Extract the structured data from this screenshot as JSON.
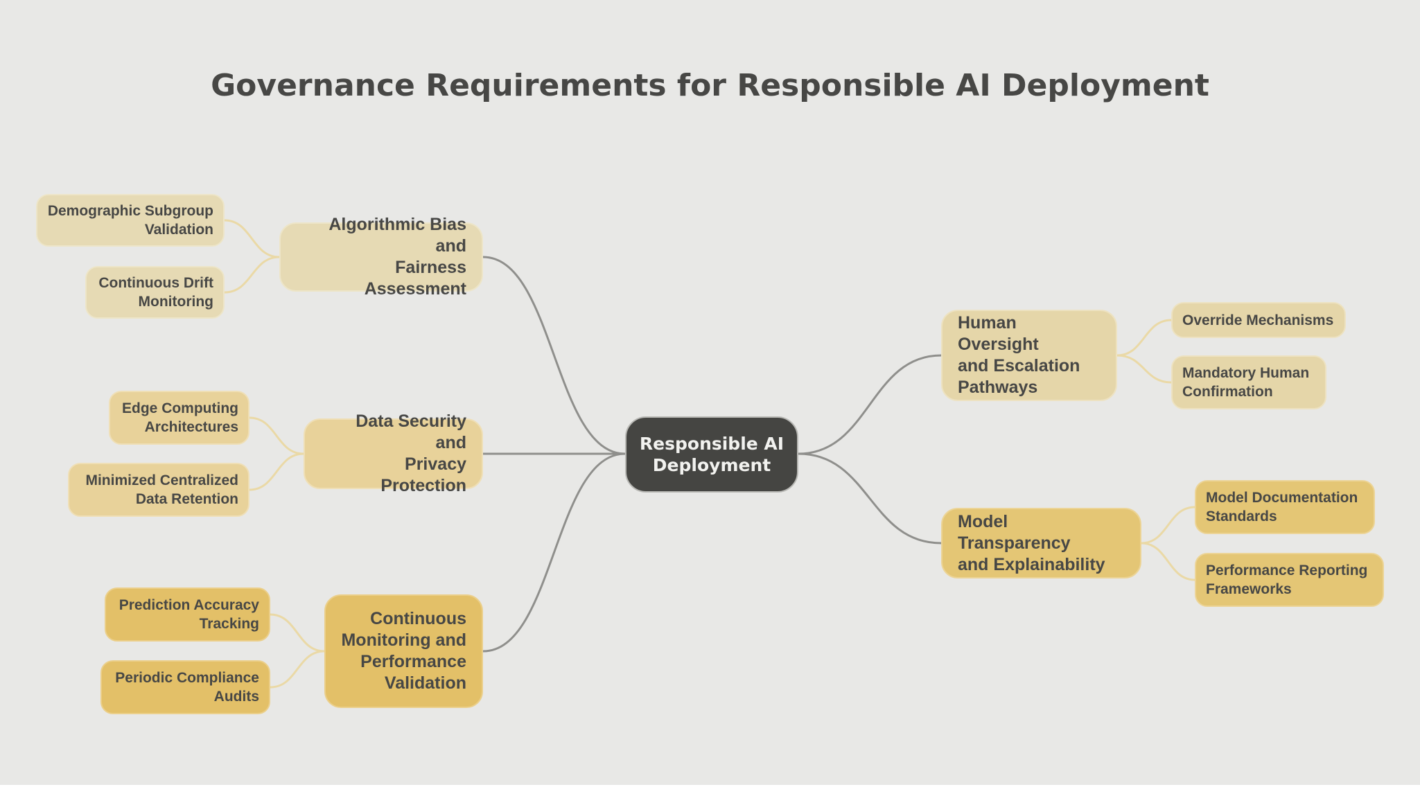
{
  "title": "Governance Requirements for Responsible AI Deployment",
  "root": {
    "label": "Responsible AI\nDeployment"
  },
  "branches": [
    {
      "label": "Algorithmic Bias and\nFairness Assessment",
      "children": [
        "Demographic Subgroup\nValidation",
        "Continuous Drift\nMonitoring"
      ]
    },
    {
      "label": "Data Security and\nPrivacy Protection",
      "children": [
        "Edge Computing\nArchitectures",
        "Minimized Centralized\nData Retention"
      ]
    },
    {
      "label": "Continuous\nMonitoring and\nPerformance\nValidation",
      "children": [
        "Prediction Accuracy\nTracking",
        "Periodic Compliance\nAudits"
      ]
    },
    {
      "label": "Human Oversight\nand Escalation\nPathways",
      "children": [
        "Override Mechanisms",
        "Mandatory Human\nConfirmation"
      ]
    },
    {
      "label": "Model Transparency\nand Explainability",
      "children": [
        "Model Documentation\nStandards",
        "Performance Reporting\nFrameworks"
      ]
    }
  ],
  "colors": {
    "background": "#e8e8e6",
    "root_fill": "#454542",
    "main_link": "#8f8f8c",
    "leaf_link": "#ead9a6",
    "text": "#474745"
  }
}
